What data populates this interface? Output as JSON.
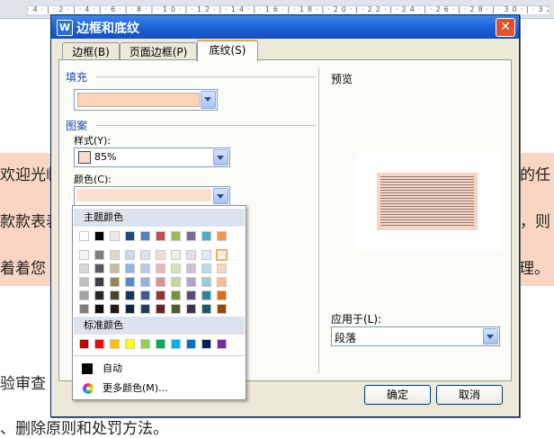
{
  "document": {
    "ruler_ticks": "·4·|·2·|·4·|·6·|·8·|·10·|·12·|·14·|·16·|·18·|·20·|·22·|·24·|·26·|·28·|·30·|·32·|·34·",
    "line1_left": "欢迎光临",
    "line1_right": "的任",
    "line2_left": "款款表表",
    "line2_right": "，则",
    "line3_left": "着着您",
    "line3_right": "管理。",
    "line4_left": "验审查",
    "line5": "、删除原则和处罚方法。"
  },
  "dialog": {
    "title": "边框和底纹",
    "app_icon": "W",
    "close_glyph": "✕",
    "tabs": [
      {
        "label": "边框(B)"
      },
      {
        "label": "页面边框(P)"
      },
      {
        "label": "底纹(S)"
      }
    ],
    "fill_group": "填充",
    "pattern_group": "图案",
    "style_label": "样式(Y):",
    "style_value": "85%",
    "color_label": "颜色(C):",
    "preview_label": "预览",
    "apply_to_label": "应用于(L):",
    "apply_to_value": "段落",
    "ok_label": "确定",
    "cancel_label": "取消"
  },
  "color_popup": {
    "theme_header": "主题颜色",
    "standard_header": "标准颜色",
    "automatic_label": "自动",
    "more_colors_label": "更多颜色(M)...",
    "theme_top_row": [
      "#ffffff",
      "#000000",
      "#eeece1",
      "#1f497d",
      "#4f81bd",
      "#c0504d",
      "#9bbb59",
      "#8064a2",
      "#4bacc6",
      "#f79646"
    ],
    "theme_shades": [
      [
        "#f2f2f2",
        "#7f7f7f",
        "#ddd9c3",
        "#c6d9f0",
        "#dbe5f1",
        "#f2dcdb",
        "#ebf1dd",
        "#e5e0ec",
        "#dbeef3",
        "#fdeada"
      ],
      [
        "#d8d8d8",
        "#595959",
        "#c4bd97",
        "#8db3e2",
        "#b8cce4",
        "#e5b9b7",
        "#d7e3bc",
        "#ccc1d9",
        "#b7dde8",
        "#fbd5b5"
      ],
      [
        "#bfbfbf",
        "#3f3f3f",
        "#938953",
        "#548dd4",
        "#95b3d7",
        "#d99694",
        "#c3d69b",
        "#b2a2c7",
        "#92cddc",
        "#fac08f"
      ],
      [
        "#a5a5a5",
        "#262626",
        "#494429",
        "#17365d",
        "#366092",
        "#953734",
        "#76923c",
        "#5f497a",
        "#31859b",
        "#e36c09"
      ],
      [
        "#7f7f7f",
        "#0c0c0c",
        "#1d1b10",
        "#0f243e",
        "#244061",
        "#632423",
        "#4f6128",
        "#3f3151",
        "#205867",
        "#974806"
      ]
    ],
    "standard_colors": [
      "#c00000",
      "#ff0000",
      "#ffc000",
      "#ffff00",
      "#92d050",
      "#00b050",
      "#00b0f0",
      "#0070c0",
      "#002060",
      "#7030a0"
    ],
    "selected_color": "#fdeada",
    "automatic_color": "#000000"
  },
  "colors": {
    "shading_fill": "#fcd3b5",
    "pattern_color": "#fbe0d0",
    "accent_tab": "#f2a33a",
    "title_bar": "#1c5cd4"
  }
}
